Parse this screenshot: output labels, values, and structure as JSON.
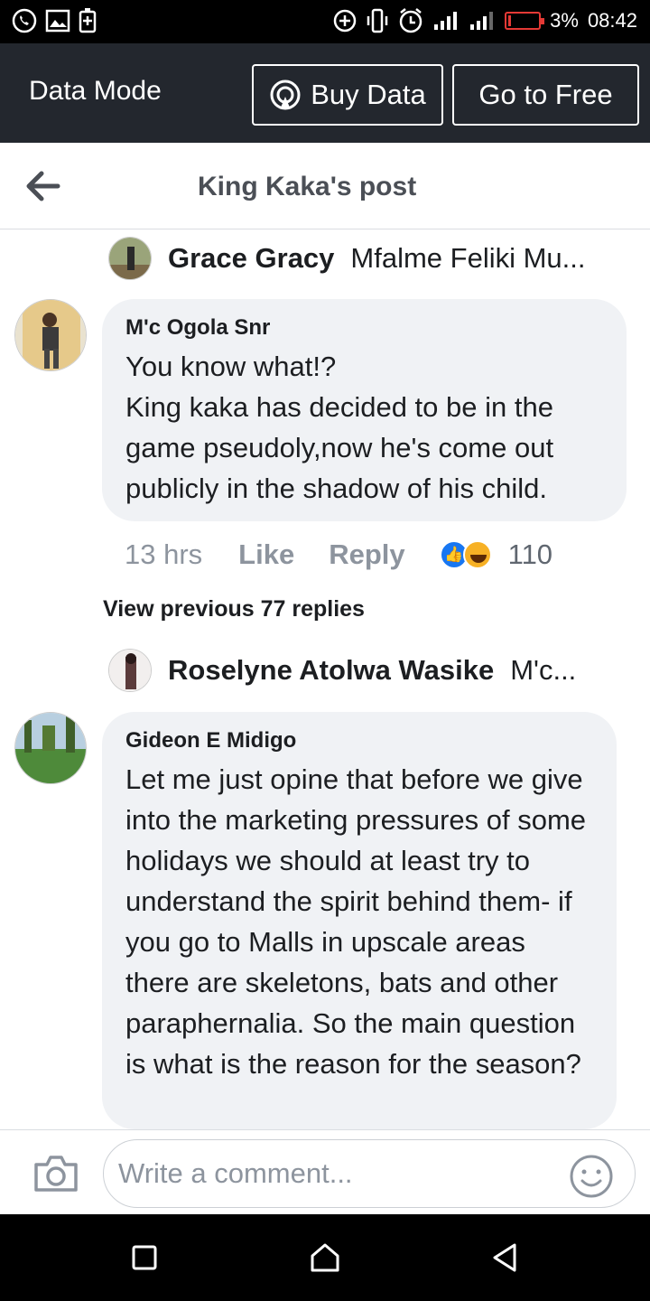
{
  "status_bar": {
    "battery": "3%",
    "time": "08:42"
  },
  "data_mode": {
    "title": "Data Mode",
    "buy_label": "Buy Data",
    "free_label": "Go to Free"
  },
  "header": {
    "title": "King Kaka's post"
  },
  "reply_previews": [
    {
      "name": "Grace Gracy",
      "snippet": "Mfalme Feliki Mu..."
    },
    {
      "name": "Roselyne Atolwa Wasike",
      "snippet": "M'c..."
    }
  ],
  "comments": [
    {
      "author": "M'c Ogola Snr",
      "text": "You know what!?\nKing kaka has decided to be in the game pseudoly,now  he's come out publicly in the shadow of his child.",
      "time": "13 hrs",
      "like_label": "Like",
      "reply_label": "Reply",
      "reaction_count": "110"
    },
    {
      "author": "Gideon E Midigo",
      "text": "Let me just opine that before we give into the marketing pressures of some holidays we should at least try to understand the spirit behind them- if you go to Malls in upscale areas there are skeletons, bats and other paraphernalia. So the main question is what is the reason for the season?"
    }
  ],
  "view_previous": "View previous 77 replies",
  "composer": {
    "placeholder": "Write a comment..."
  },
  "colors": {
    "data_bar": "#23272e",
    "bubble": "#f0f2f5",
    "like_blue": "#1877f2",
    "battery_red": "#e53935"
  }
}
